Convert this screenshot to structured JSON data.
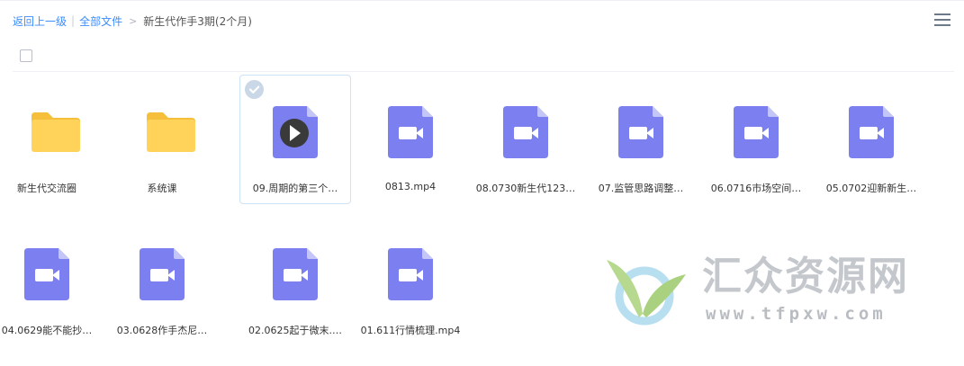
{
  "breadcrumb": {
    "back": "返回上一级",
    "all_files": "全部文件",
    "separator_bar": "|",
    "separator_arrow": ">",
    "current": "新生代作手3期(2个月)"
  },
  "files": [
    {
      "name": "新生代交流圈",
      "type": "folder"
    },
    {
      "name": "系统课",
      "type": "folder"
    },
    {
      "name": "09.周期的第三个…",
      "type": "video",
      "selected": true,
      "playing": true
    },
    {
      "name": "0813.mp4",
      "type": "video"
    },
    {
      "name": "08.0730新生代123…",
      "type": "video"
    },
    {
      "name": "07.监管思路调整…",
      "type": "video"
    },
    {
      "name": "06.0716市场空间…",
      "type": "video"
    },
    {
      "name": "05.0702迎新新生…",
      "type": "video"
    },
    {
      "name": "04.0629能不能抄…",
      "type": "video"
    },
    {
      "name": "03.0628作手杰尼…",
      "type": "video"
    },
    {
      "name": "02.0625起于微末.…",
      "type": "video"
    },
    {
      "name": "01.611行情梳理.mp4",
      "type": "video"
    }
  ],
  "watermark": {
    "title": "汇众资源网",
    "url": "www.tfpxw.com"
  },
  "colors": {
    "link": "#3b8cff",
    "folder": "#ffd25a",
    "folder_tab": "#f5bf3c",
    "video": "#7b7ff0",
    "video_fold": "#c4c6f8",
    "selected_border": "#cfe3f7"
  }
}
